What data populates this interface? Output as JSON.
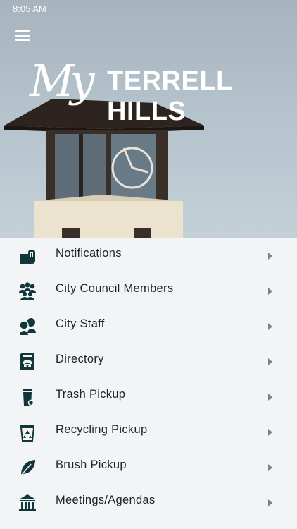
{
  "status_bar": {
    "time": "8:05 AM"
  },
  "logo": {
    "script": "My",
    "block": "TERRELL HILLS"
  },
  "menu_items": [
    {
      "label": "Notifications",
      "icon": "mailbox-icon"
    },
    {
      "label": "City Council Members",
      "icon": "group-icon"
    },
    {
      "label": "City Staff",
      "icon": "staff-icon"
    },
    {
      "label": "Directory",
      "icon": "phone-book-icon"
    },
    {
      "label": "Trash Pickup",
      "icon": "trash-bin-icon"
    },
    {
      "label": "Recycling Pickup",
      "icon": "recycle-bin-icon"
    },
    {
      "label": "Brush Pickup",
      "icon": "leaf-icon"
    },
    {
      "label": "Meetings/Agendas",
      "icon": "building-icon"
    }
  ],
  "colors": {
    "icon": "#12373b",
    "chevron": "#7c8288",
    "list_bg": "#f3f4f6"
  }
}
